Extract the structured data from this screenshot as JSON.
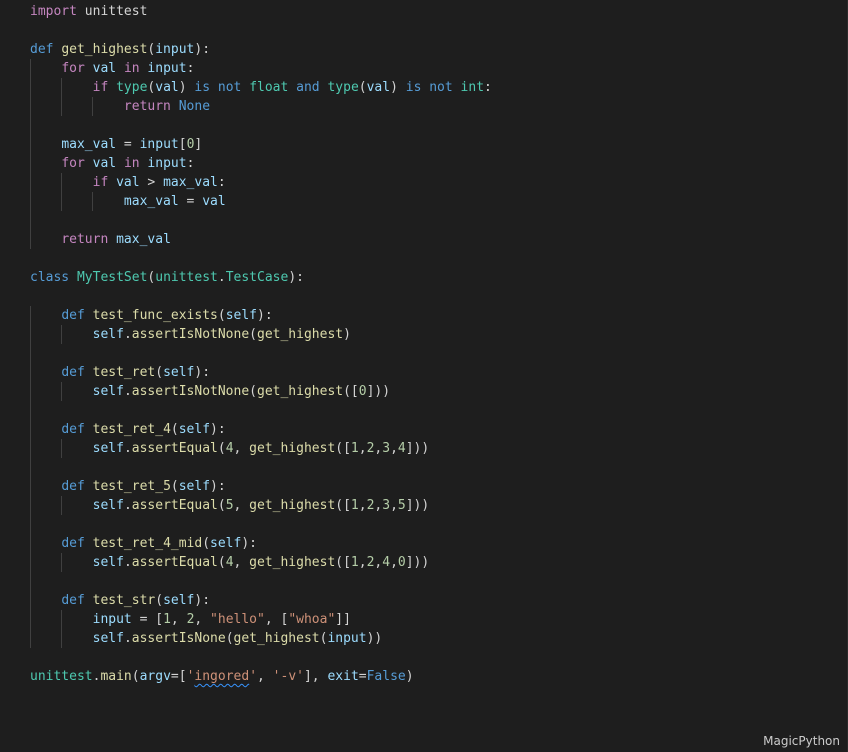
{
  "editor": {
    "language_mode": "MagicPython",
    "colors": {
      "background": "#1e1e1e",
      "keyword": "#569cd6",
      "control": "#c586c0",
      "function": "#dcdcaa",
      "variable": "#9cdcfe",
      "class": "#4ec9b0",
      "number": "#b5cea8",
      "string": "#ce9178",
      "text": "#d4d4d4"
    },
    "lines": [
      [
        {
          "t": "import",
          "c": "ctl"
        },
        {
          "t": " unittest",
          "c": "pln"
        }
      ],
      [],
      [
        {
          "t": "def",
          "c": "kw"
        },
        {
          "t": " ",
          "c": "pln"
        },
        {
          "t": "get_highest",
          "c": "fn"
        },
        {
          "t": "(",
          "c": "pln"
        },
        {
          "t": "input",
          "c": "var"
        },
        {
          "t": "):",
          "c": "pln"
        }
      ],
      [
        {
          "t": "    ",
          "c": "pln"
        },
        {
          "t": "for",
          "c": "ctl"
        },
        {
          "t": " ",
          "c": "pln"
        },
        {
          "t": "val",
          "c": "var"
        },
        {
          "t": " ",
          "c": "pln"
        },
        {
          "t": "in",
          "c": "ctl"
        },
        {
          "t": " ",
          "c": "pln"
        },
        {
          "t": "input",
          "c": "var"
        },
        {
          "t": ":",
          "c": "pln"
        }
      ],
      [
        {
          "t": "        ",
          "c": "pln"
        },
        {
          "t": "if",
          "c": "ctl"
        },
        {
          "t": " ",
          "c": "pln"
        },
        {
          "t": "type",
          "c": "cls"
        },
        {
          "t": "(",
          "c": "pln"
        },
        {
          "t": "val",
          "c": "var"
        },
        {
          "t": ") ",
          "c": "pln"
        },
        {
          "t": "is not",
          "c": "kw"
        },
        {
          "t": " ",
          "c": "pln"
        },
        {
          "t": "float",
          "c": "cls"
        },
        {
          "t": " ",
          "c": "pln"
        },
        {
          "t": "and",
          "c": "kw"
        },
        {
          "t": " ",
          "c": "pln"
        },
        {
          "t": "type",
          "c": "cls"
        },
        {
          "t": "(",
          "c": "pln"
        },
        {
          "t": "val",
          "c": "var"
        },
        {
          "t": ") ",
          "c": "pln"
        },
        {
          "t": "is not",
          "c": "kw"
        },
        {
          "t": " ",
          "c": "pln"
        },
        {
          "t": "int",
          "c": "cls"
        },
        {
          "t": ":",
          "c": "pln"
        }
      ],
      [
        {
          "t": "            ",
          "c": "pln"
        },
        {
          "t": "return",
          "c": "ctl"
        },
        {
          "t": " ",
          "c": "pln"
        },
        {
          "t": "None",
          "c": "kw"
        }
      ],
      [],
      [
        {
          "t": "    ",
          "c": "pln"
        },
        {
          "t": "max_val",
          "c": "var"
        },
        {
          "t": " = ",
          "c": "pln"
        },
        {
          "t": "input",
          "c": "var"
        },
        {
          "t": "[",
          "c": "pln"
        },
        {
          "t": "0",
          "c": "num"
        },
        {
          "t": "]",
          "c": "pln"
        }
      ],
      [
        {
          "t": "    ",
          "c": "pln"
        },
        {
          "t": "for",
          "c": "ctl"
        },
        {
          "t": " ",
          "c": "pln"
        },
        {
          "t": "val",
          "c": "var"
        },
        {
          "t": " ",
          "c": "pln"
        },
        {
          "t": "in",
          "c": "ctl"
        },
        {
          "t": " ",
          "c": "pln"
        },
        {
          "t": "input",
          "c": "var"
        },
        {
          "t": ":",
          "c": "pln"
        }
      ],
      [
        {
          "t": "        ",
          "c": "pln"
        },
        {
          "t": "if",
          "c": "ctl"
        },
        {
          "t": " ",
          "c": "pln"
        },
        {
          "t": "val",
          "c": "var"
        },
        {
          "t": " > ",
          "c": "pln"
        },
        {
          "t": "max_val",
          "c": "var"
        },
        {
          "t": ":",
          "c": "pln"
        }
      ],
      [
        {
          "t": "            ",
          "c": "pln"
        },
        {
          "t": "max_val",
          "c": "var"
        },
        {
          "t": " = ",
          "c": "pln"
        },
        {
          "t": "val",
          "c": "var"
        }
      ],
      [],
      [
        {
          "t": "    ",
          "c": "pln"
        },
        {
          "t": "return",
          "c": "ctl"
        },
        {
          "t": " ",
          "c": "pln"
        },
        {
          "t": "max_val",
          "c": "var"
        }
      ],
      [],
      [
        {
          "t": "class",
          "c": "kw"
        },
        {
          "t": " ",
          "c": "pln"
        },
        {
          "t": "MyTestSet",
          "c": "cls"
        },
        {
          "t": "(",
          "c": "pln"
        },
        {
          "t": "unittest",
          "c": "cls"
        },
        {
          "t": ".",
          "c": "pln"
        },
        {
          "t": "TestCase",
          "c": "cls"
        },
        {
          "t": "):",
          "c": "pln"
        }
      ],
      [],
      [
        {
          "t": "    ",
          "c": "pln"
        },
        {
          "t": "def",
          "c": "kw"
        },
        {
          "t": " ",
          "c": "pln"
        },
        {
          "t": "test_func_exists",
          "c": "fn"
        },
        {
          "t": "(",
          "c": "pln"
        },
        {
          "t": "self",
          "c": "var"
        },
        {
          "t": "):",
          "c": "pln"
        }
      ],
      [
        {
          "t": "        ",
          "c": "pln"
        },
        {
          "t": "self",
          "c": "var"
        },
        {
          "t": ".",
          "c": "pln"
        },
        {
          "t": "assertIsNotNone",
          "c": "fn"
        },
        {
          "t": "(",
          "c": "pln"
        },
        {
          "t": "get_highest",
          "c": "fn"
        },
        {
          "t": ")",
          "c": "pln"
        }
      ],
      [],
      [
        {
          "t": "    ",
          "c": "pln"
        },
        {
          "t": "def",
          "c": "kw"
        },
        {
          "t": " ",
          "c": "pln"
        },
        {
          "t": "test_ret",
          "c": "fn"
        },
        {
          "t": "(",
          "c": "pln"
        },
        {
          "t": "self",
          "c": "var"
        },
        {
          "t": "):",
          "c": "pln"
        }
      ],
      [
        {
          "t": "        ",
          "c": "pln"
        },
        {
          "t": "self",
          "c": "var"
        },
        {
          "t": ".",
          "c": "pln"
        },
        {
          "t": "assertIsNotNone",
          "c": "fn"
        },
        {
          "t": "(",
          "c": "pln"
        },
        {
          "t": "get_highest",
          "c": "fn"
        },
        {
          "t": "([",
          "c": "pln"
        },
        {
          "t": "0",
          "c": "num"
        },
        {
          "t": "]))",
          "c": "pln"
        }
      ],
      [],
      [
        {
          "t": "    ",
          "c": "pln"
        },
        {
          "t": "def",
          "c": "kw"
        },
        {
          "t": " ",
          "c": "pln"
        },
        {
          "t": "test_ret_4",
          "c": "fn"
        },
        {
          "t": "(",
          "c": "pln"
        },
        {
          "t": "self",
          "c": "var"
        },
        {
          "t": "):",
          "c": "pln"
        }
      ],
      [
        {
          "t": "        ",
          "c": "pln"
        },
        {
          "t": "self",
          "c": "var"
        },
        {
          "t": ".",
          "c": "pln"
        },
        {
          "t": "assertEqual",
          "c": "fn"
        },
        {
          "t": "(",
          "c": "pln"
        },
        {
          "t": "4",
          "c": "num"
        },
        {
          "t": ", ",
          "c": "pln"
        },
        {
          "t": "get_highest",
          "c": "fn"
        },
        {
          "t": "([",
          "c": "pln"
        },
        {
          "t": "1",
          "c": "num"
        },
        {
          "t": ",",
          "c": "pln"
        },
        {
          "t": "2",
          "c": "num"
        },
        {
          "t": ",",
          "c": "pln"
        },
        {
          "t": "3",
          "c": "num"
        },
        {
          "t": ",",
          "c": "pln"
        },
        {
          "t": "4",
          "c": "num"
        },
        {
          "t": "]))",
          "c": "pln"
        }
      ],
      [],
      [
        {
          "t": "    ",
          "c": "pln"
        },
        {
          "t": "def",
          "c": "kw"
        },
        {
          "t": " ",
          "c": "pln"
        },
        {
          "t": "test_ret_5",
          "c": "fn"
        },
        {
          "t": "(",
          "c": "pln"
        },
        {
          "t": "self",
          "c": "var"
        },
        {
          "t": "):",
          "c": "pln"
        }
      ],
      [
        {
          "t": "        ",
          "c": "pln"
        },
        {
          "t": "self",
          "c": "var"
        },
        {
          "t": ".",
          "c": "pln"
        },
        {
          "t": "assertEqual",
          "c": "fn"
        },
        {
          "t": "(",
          "c": "pln"
        },
        {
          "t": "5",
          "c": "num"
        },
        {
          "t": ", ",
          "c": "pln"
        },
        {
          "t": "get_highest",
          "c": "fn"
        },
        {
          "t": "([",
          "c": "pln"
        },
        {
          "t": "1",
          "c": "num"
        },
        {
          "t": ",",
          "c": "pln"
        },
        {
          "t": "2",
          "c": "num"
        },
        {
          "t": ",",
          "c": "pln"
        },
        {
          "t": "3",
          "c": "num"
        },
        {
          "t": ",",
          "c": "pln"
        },
        {
          "t": "5",
          "c": "num"
        },
        {
          "t": "]))",
          "c": "pln"
        }
      ],
      [],
      [
        {
          "t": "    ",
          "c": "pln"
        },
        {
          "t": "def",
          "c": "kw"
        },
        {
          "t": " ",
          "c": "pln"
        },
        {
          "t": "test_ret_4_mid",
          "c": "fn"
        },
        {
          "t": "(",
          "c": "pln"
        },
        {
          "t": "self",
          "c": "var"
        },
        {
          "t": "):",
          "c": "pln"
        }
      ],
      [
        {
          "t": "        ",
          "c": "pln"
        },
        {
          "t": "self",
          "c": "var"
        },
        {
          "t": ".",
          "c": "pln"
        },
        {
          "t": "assertEqual",
          "c": "fn"
        },
        {
          "t": "(",
          "c": "pln"
        },
        {
          "t": "4",
          "c": "num"
        },
        {
          "t": ", ",
          "c": "pln"
        },
        {
          "t": "get_highest",
          "c": "fn"
        },
        {
          "t": "([",
          "c": "pln"
        },
        {
          "t": "1",
          "c": "num"
        },
        {
          "t": ",",
          "c": "pln"
        },
        {
          "t": "2",
          "c": "num"
        },
        {
          "t": ",",
          "c": "pln"
        },
        {
          "t": "4",
          "c": "num"
        },
        {
          "t": ",",
          "c": "pln"
        },
        {
          "t": "0",
          "c": "num"
        },
        {
          "t": "]))",
          "c": "pln"
        }
      ],
      [],
      [
        {
          "t": "    ",
          "c": "pln"
        },
        {
          "t": "def",
          "c": "kw"
        },
        {
          "t": " ",
          "c": "pln"
        },
        {
          "t": "test_str",
          "c": "fn"
        },
        {
          "t": "(",
          "c": "pln"
        },
        {
          "t": "self",
          "c": "var"
        },
        {
          "t": "):",
          "c": "pln"
        }
      ],
      [
        {
          "t": "        ",
          "c": "pln"
        },
        {
          "t": "input",
          "c": "var"
        },
        {
          "t": " = [",
          "c": "pln"
        },
        {
          "t": "1",
          "c": "num"
        },
        {
          "t": ", ",
          "c": "pln"
        },
        {
          "t": "2",
          "c": "num"
        },
        {
          "t": ", ",
          "c": "pln"
        },
        {
          "t": "\"hello\"",
          "c": "str"
        },
        {
          "t": ", [",
          "c": "pln"
        },
        {
          "t": "\"whoa\"",
          "c": "str"
        },
        {
          "t": "]]",
          "c": "pln"
        }
      ],
      [
        {
          "t": "        ",
          "c": "pln"
        },
        {
          "t": "self",
          "c": "var"
        },
        {
          "t": ".",
          "c": "pln"
        },
        {
          "t": "assertIsNone",
          "c": "fn"
        },
        {
          "t": "(",
          "c": "pln"
        },
        {
          "t": "get_highest",
          "c": "fn"
        },
        {
          "t": "(",
          "c": "pln"
        },
        {
          "t": "input",
          "c": "var"
        },
        {
          "t": "))",
          "c": "pln"
        }
      ],
      [],
      [
        {
          "t": "unittest",
          "c": "cls"
        },
        {
          "t": ".",
          "c": "pln"
        },
        {
          "t": "main",
          "c": "fn"
        },
        {
          "t": "(",
          "c": "pln"
        },
        {
          "t": "argv",
          "c": "var"
        },
        {
          "t": "=[",
          "c": "pln"
        },
        {
          "t": "'",
          "c": "str"
        },
        {
          "t": "ingored",
          "c": "str",
          "squiggle": true
        },
        {
          "t": "'",
          "c": "str"
        },
        {
          "t": ", ",
          "c": "pln"
        },
        {
          "t": "'-v'",
          "c": "str"
        },
        {
          "t": "], ",
          "c": "pln"
        },
        {
          "t": "exit",
          "c": "var"
        },
        {
          "t": "=",
          "c": "pln"
        },
        {
          "t": "False",
          "c": "kw"
        },
        {
          "t": ")",
          "c": "pln"
        }
      ]
    ]
  }
}
